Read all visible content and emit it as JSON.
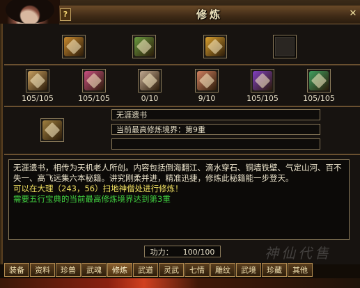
{
  "window": {
    "title": "修炼",
    "help_label": "?",
    "close_label": "✕"
  },
  "top_items": [
    {
      "icon": "tome-icon",
      "color": "#c88a30"
    },
    {
      "icon": "scroll-bundle-icon",
      "color": "#6a9a40"
    },
    {
      "icon": "golden-tome-icon",
      "color": "#d8a030"
    },
    {
      "icon": "empty-slot-icon",
      "color": "#2a2622"
    }
  ],
  "scrolls": [
    {
      "icon": "scroll-icon",
      "color": "#c8a060",
      "count": "105/105"
    },
    {
      "icon": "scroll-icon",
      "color": "#c85080",
      "count": "105/105"
    },
    {
      "icon": "scroll-icon",
      "color": "#c0a890",
      "count": "0/10"
    },
    {
      "icon": "scroll-icon",
      "color": "#d08060",
      "count": "9/10"
    },
    {
      "icon": "scroll-icon",
      "color": "#8040c0",
      "count": "105/105"
    },
    {
      "icon": "scroll-icon",
      "color": "#40a060",
      "count": "105/105"
    }
  ],
  "selected": {
    "icon": "selected-scroll-icon",
    "color": "#a08040",
    "name": "无涯遗书",
    "realm": "当前最高修炼境界：第9重",
    "extra": ""
  },
  "description": {
    "line1": "无涯遗书，相传为天机老人所创。内容包括倒海翻江、滴水穿石、铜墙铁壁、气定山河、百不失一、高飞远集六本秘籍。讲究刚柔并进，精准迅捷，修炼此秘籍能一步登天。",
    "line2": "可以在大理（243，56）扫地神僧处进行修炼！",
    "line3": "需要五行宝典的当前最高修炼境界达到第3重"
  },
  "power": {
    "label": "功力：",
    "value": "100/100"
  },
  "tabs": [
    "装备",
    "资料",
    "珍兽",
    "武魂",
    "修炼",
    "武道",
    "灵武",
    "七情",
    "雕纹",
    "武境",
    "珍藏",
    "其他"
  ],
  "active_tab": "修炼",
  "watermark": "神仙代售"
}
